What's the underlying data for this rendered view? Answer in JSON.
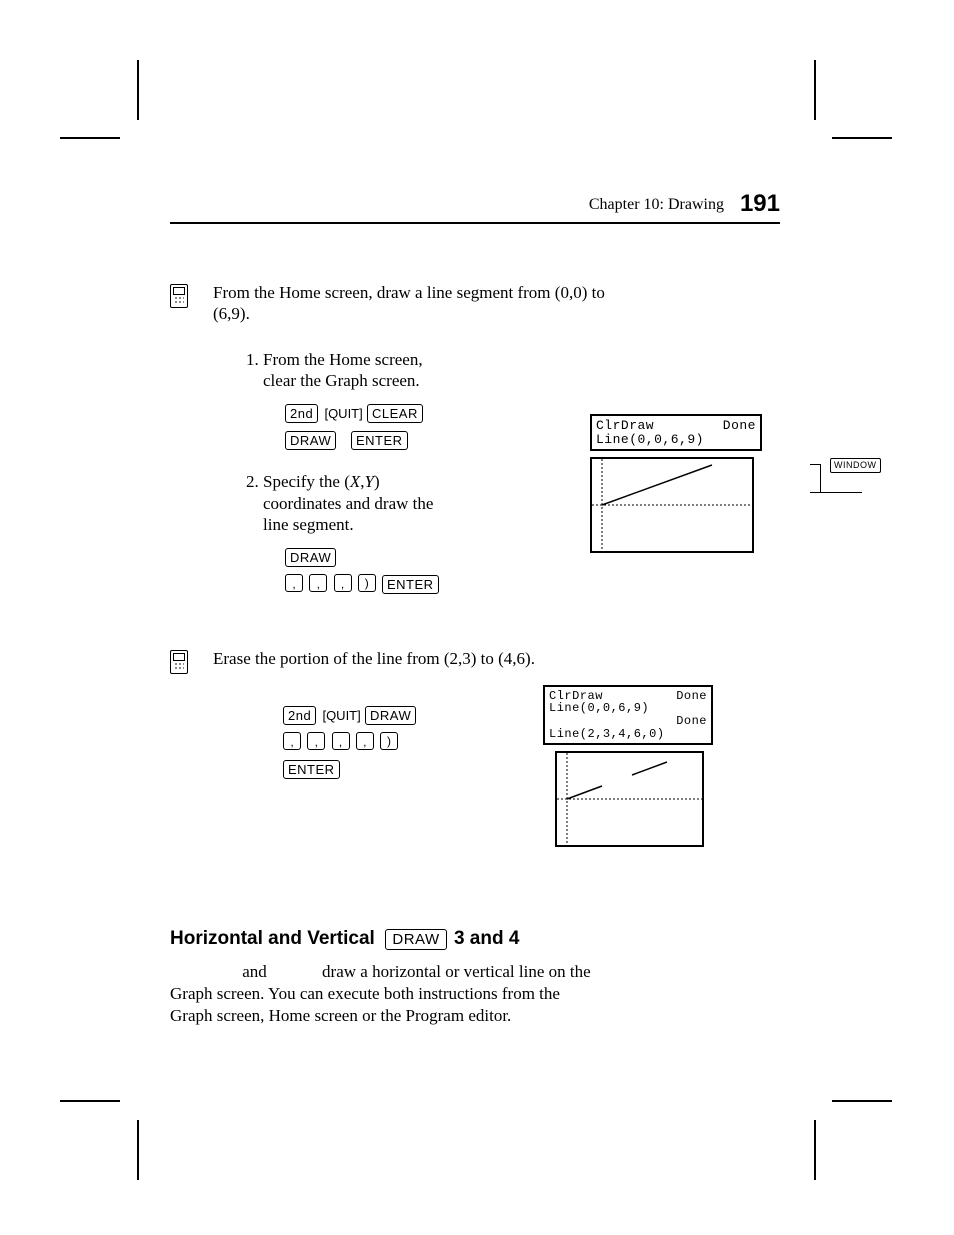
{
  "header": {
    "chapter": "Chapter 10: Drawing",
    "page": "191"
  },
  "example1": {
    "intro_a": "From the Home screen, draw a line segment from (0,0) to",
    "intro_b": "(6,9).",
    "steps": [
      {
        "num": "1.",
        "text_a": "From the Home screen,",
        "text_b": "clear the Graph screen.",
        "keys_row1": [
          "2nd",
          "[QUIT]",
          "CLEAR"
        ],
        "keys_row2": [
          "DRAW",
          "ENTER"
        ]
      },
      {
        "num": "2.",
        "text_a": "Specify the (X,Y)",
        "text_b": "coordinates and draw the",
        "text_c": "line segment.",
        "keys_row1": [
          "DRAW"
        ],
        "keys_row2_chips": 3,
        "keys_row2_paren": 1,
        "keys_row2_trailing": [
          "ENTER"
        ]
      }
    ],
    "window_label": "WINDOW",
    "screen1": {
      "line1_left": "ClrDraw",
      "line1_right": "Done",
      "line2": "Line(0,0,6,9)"
    }
  },
  "example2": {
    "intro": "Erase the portion of the line from (2,3) to (4,6).",
    "keys_row1": [
      "2nd",
      "[QUIT]",
      "DRAW"
    ],
    "keys_row2_chips": 4,
    "keys_row2_paren": 1,
    "keys_row3": [
      "ENTER"
    ],
    "screen": {
      "line1_left": "ClrDraw",
      "line1_right": "Done",
      "line2": "Line(0,0,6,9)",
      "line2_right": "Done",
      "line3": "Line(2,3,4,6,0)"
    }
  },
  "section": {
    "heading_a": "Horizontal and Vertical",
    "heading_key": "DRAW",
    "heading_b": "3 and 4",
    "body_a": "and",
    "body_b": "draw a horizontal or vertical line on the",
    "body_c": "Graph screen. You can execute both instructions from the",
    "body_d": "Graph screen, Home screen or the Program editor."
  }
}
